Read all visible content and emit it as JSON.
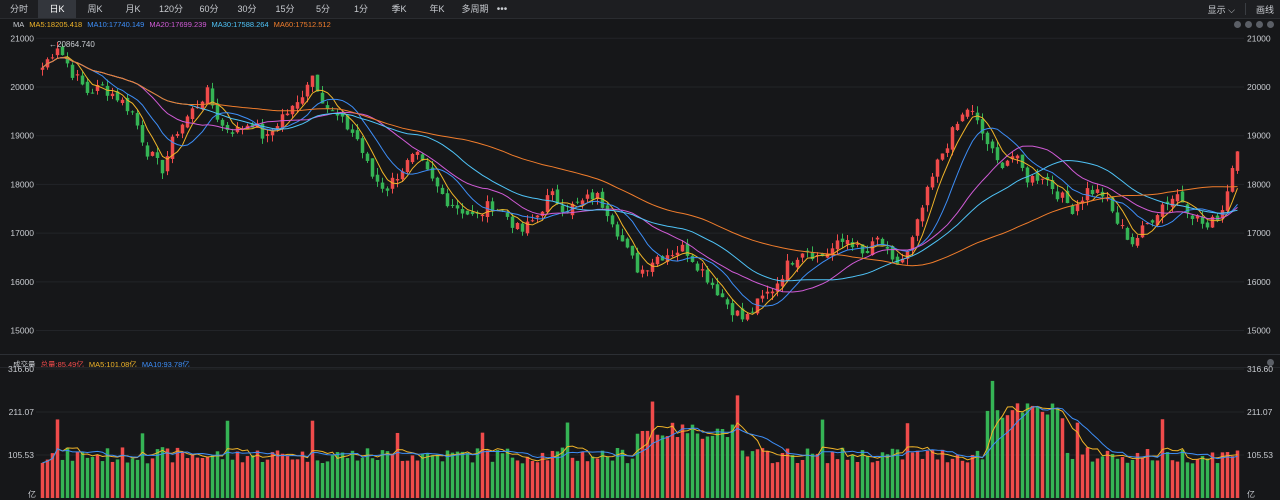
{
  "toolbar": {
    "periods": [
      "分时",
      "日K",
      "周K",
      "月K",
      "120分",
      "60分",
      "30分",
      "15分",
      "5分",
      "1分",
      "季K",
      "年K",
      "多周期"
    ],
    "active": "日K",
    "more_label": "•••",
    "display_label": "显示",
    "draw_label": "画线"
  },
  "price_legend": {
    "title": "MA",
    "items": [
      {
        "label": "MA5:18205.418",
        "color": "#f0b429"
      },
      {
        "label": "MA10:17740.149",
        "color": "#3d8ef7"
      },
      {
        "label": "MA20:17699.239",
        "color": "#d05bd6"
      },
      {
        "label": "MA30:17588.264",
        "color": "#4fc3f7"
      },
      {
        "label": "MA60:17512.512",
        "color": "#f07d2c"
      }
    ]
  },
  "volume_legend": {
    "title": "成交量",
    "items": [
      {
        "label": "总量:85.49亿",
        "color": "#ef4b4b"
      },
      {
        "label": "MA5:101.08亿",
        "color": "#f0b429"
      },
      {
        "label": "MA10:93.78亿",
        "color": "#3d8ef7"
      }
    ]
  },
  "chart_data": [
    {
      "type": "candlestick",
      "ylim": [
        14600,
        21150
      ],
      "y_ticks": [
        21000,
        20000,
        19000,
        18000,
        17000,
        16000,
        15000
      ],
      "y_tick_labels": [
        "21000",
        "20000",
        "19000",
        "18000",
        "17000",
        "16000",
        "15000"
      ],
      "high_annotation": "←20864.740",
      "high_value": 20864.74,
      "close_path": [
        20400,
        20860,
        20300,
        19900,
        20000,
        19800,
        19500,
        18700,
        18300,
        19100,
        19500,
        19900,
        19200,
        19100,
        19300,
        18900,
        19400,
        19600,
        20300,
        19600,
        19300,
        19000,
        18200,
        17900,
        18300,
        18600,
        18100,
        17700,
        17500,
        17300,
        17600,
        17400,
        17000,
        17300,
        17800,
        17500,
        17600,
        17800,
        17400,
        16700,
        16200,
        16500,
        16600,
        16700,
        16300,
        15900,
        15500,
        15200,
        15600,
        15900,
        16400,
        16700,
        16500,
        16700,
        16900,
        16500,
        16900,
        16300,
        16600,
        17600,
        18500,
        19100,
        19600,
        19000,
        18400,
        18600,
        18100,
        18200,
        17800,
        17500,
        17900,
        17800,
        17200,
        16800,
        17200,
        17600,
        17800,
        17400,
        17100,
        17500,
        18800
      ],
      "volume_ylim": [
        0,
        316.6
      ],
      "volume_y_ticks": [
        316.6,
        211.07,
        105.53
      ],
      "volume_tick_labels": [
        "316.60",
        "211.07",
        "105.53"
      ],
      "volume_unit": "亿"
    }
  ]
}
